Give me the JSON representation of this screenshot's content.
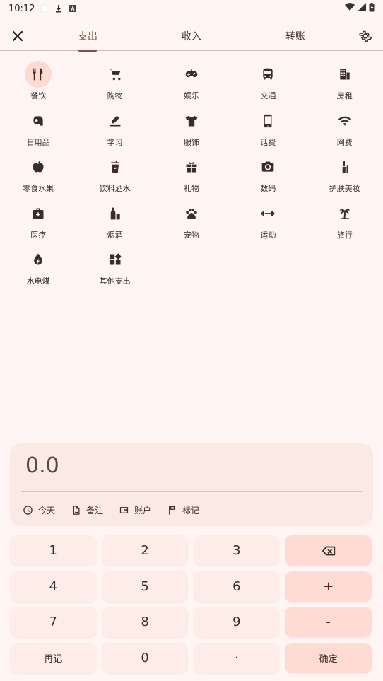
{
  "status_bar": {
    "time": "10:12"
  },
  "tabs": [
    {
      "label": "支出",
      "active": true
    },
    {
      "label": "收入",
      "active": false
    },
    {
      "label": "转账",
      "active": false
    }
  ],
  "categories": [
    {
      "label": "餐饮",
      "icon": "restaurant-icon",
      "selected": true
    },
    {
      "label": "购物",
      "icon": "shopping-cart-icon"
    },
    {
      "label": "娱乐",
      "icon": "gamepad-icon"
    },
    {
      "label": "交通",
      "icon": "bus-icon"
    },
    {
      "label": "房租",
      "icon": "building-icon"
    },
    {
      "label": "日用品",
      "icon": "toilet-paper-icon"
    },
    {
      "label": "学习",
      "icon": "pen-icon"
    },
    {
      "label": "服饰",
      "icon": "shirt-icon"
    },
    {
      "label": "话费",
      "icon": "phone-icon"
    },
    {
      "label": "网费",
      "icon": "wifi-icon"
    },
    {
      "label": "零食水果",
      "icon": "apple-icon"
    },
    {
      "label": "饮料酒水",
      "icon": "cup-icon"
    },
    {
      "label": "礼物",
      "icon": "gift-icon"
    },
    {
      "label": "数码",
      "icon": "camera-icon"
    },
    {
      "label": "护肤美妆",
      "icon": "lipstick-icon"
    },
    {
      "label": "医疗",
      "icon": "medical-kit-icon"
    },
    {
      "label": "烟酒",
      "icon": "bottle-icon"
    },
    {
      "label": "宠物",
      "icon": "paw-icon"
    },
    {
      "label": "运动",
      "icon": "dumbbell-icon"
    },
    {
      "label": "旅行",
      "icon": "palm-tree-icon"
    },
    {
      "label": "水电煤",
      "icon": "utility-drop-icon"
    },
    {
      "label": "其他支出",
      "icon": "widgets-icon"
    }
  ],
  "amount": "0.0",
  "meta": {
    "date": "今天",
    "note": "备注",
    "account": "账户",
    "tag": "标记"
  },
  "keypad": {
    "k1": "1",
    "k2": "2",
    "k3": "3",
    "k4": "4",
    "k5": "5",
    "k6": "6",
    "plus": "+",
    "k7": "7",
    "k8": "8",
    "k9": "9",
    "minus": "-",
    "again": "再记",
    "k0": "0",
    "dot": "·",
    "confirm": "确定"
  },
  "colors": {
    "background": "#fff5f3",
    "accent": "#8a4a3a",
    "selected_icon_bg": "#ffd9d2"
  }
}
